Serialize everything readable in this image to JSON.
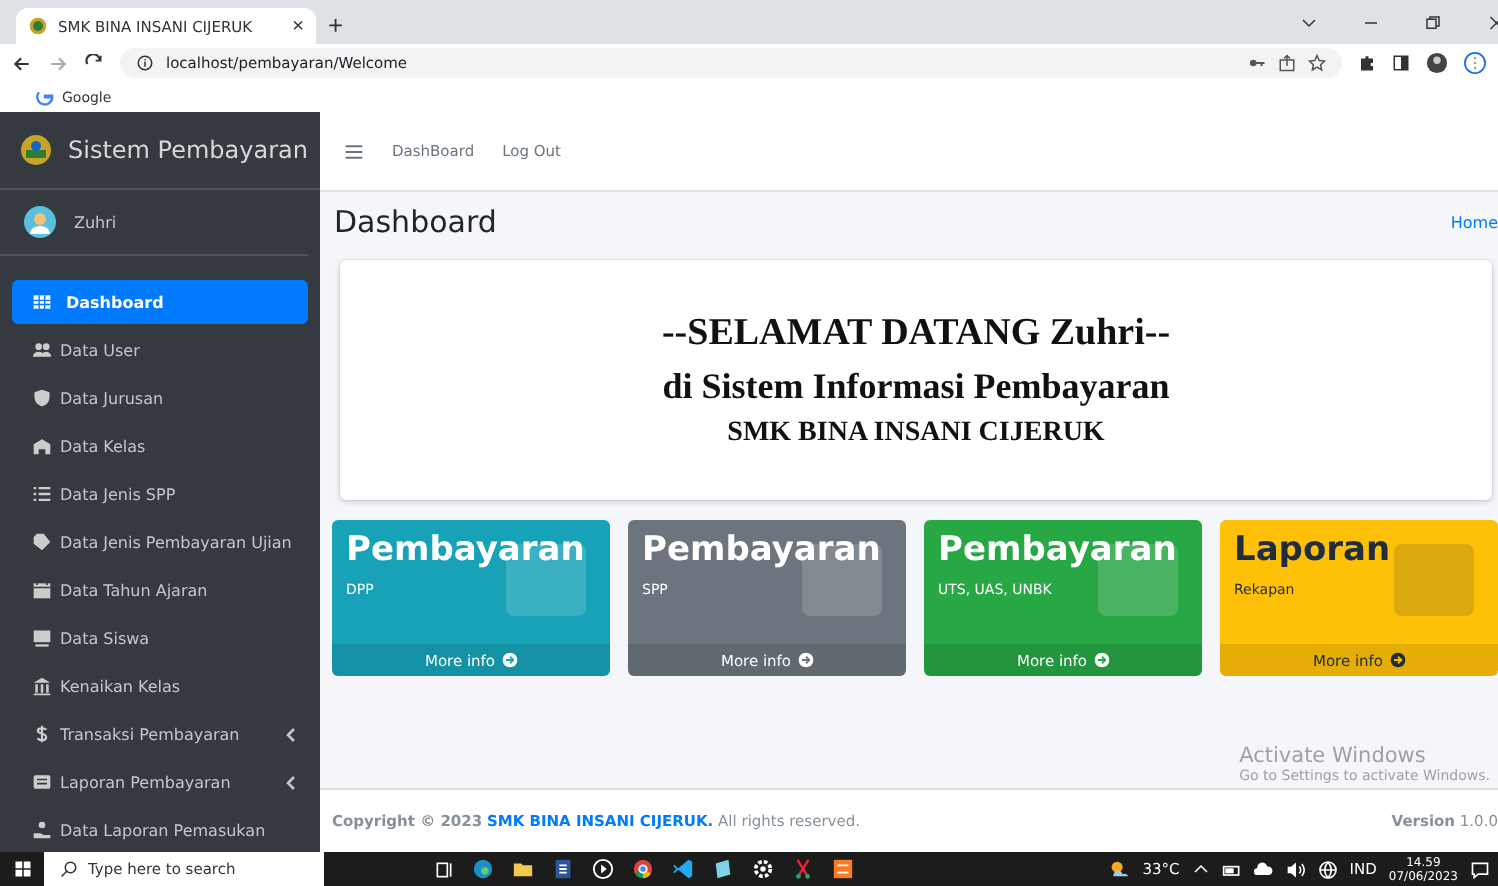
{
  "browser": {
    "tab_title": "SMK BINA INSANI CIJERUK",
    "new_tab": "+",
    "close_tab": "×",
    "url": "localhost/pembayaran/Welcome",
    "bookmark": "Google"
  },
  "sidebar": {
    "brand": "Sistem Pembayaran",
    "user": "Zuhri",
    "items": [
      {
        "label": "Dashboard",
        "selected": true,
        "has_submenu": false
      },
      {
        "label": "Data User",
        "selected": false,
        "has_submenu": false
      },
      {
        "label": "Data Jurusan",
        "selected": false,
        "has_submenu": false
      },
      {
        "label": "Data Kelas",
        "selected": false,
        "has_submenu": false
      },
      {
        "label": "Data Jenis SPP",
        "selected": false,
        "has_submenu": false
      },
      {
        "label": "Data Jenis Pembayaran Ujian",
        "selected": false,
        "has_submenu": false
      },
      {
        "label": "Data Tahun Ajaran",
        "selected": false,
        "has_submenu": false
      },
      {
        "label": "Data Siswa",
        "selected": false,
        "has_submenu": false
      },
      {
        "label": "Kenaikan Kelas",
        "selected": false,
        "has_submenu": false
      },
      {
        "label": "Transaksi Pembayaran",
        "selected": false,
        "has_submenu": true
      },
      {
        "label": "Laporan Pembayaran",
        "selected": false,
        "has_submenu": true
      },
      {
        "label": "Data Laporan Pemasukan",
        "selected": false,
        "has_submenu": false
      }
    ]
  },
  "navbar": {
    "links": [
      "DashBoard",
      "Log Out"
    ]
  },
  "page": {
    "title": "Dashboard",
    "breadcrumb": "Home"
  },
  "welcome": {
    "line1": "--SELAMAT DATANG Zuhri--",
    "line2": "di Sistem Informasi Pembayaran",
    "line3": "SMK BINA INSANI CIJERUK"
  },
  "boxes": [
    {
      "title": "Pembayaran",
      "subtitle": "DPP",
      "link": "More info",
      "color": "#17a2b8"
    },
    {
      "title": "Pembayaran",
      "subtitle": "SPP",
      "link": "More info",
      "color": "#6c757d"
    },
    {
      "title": "Pembayaran",
      "subtitle": "UTS, UAS, UNBK",
      "link": "More info",
      "color": "#28a745"
    },
    {
      "title": "Laporan",
      "subtitle": "Rekapan",
      "link": "More info",
      "color": "#ffc107"
    }
  ],
  "footer": {
    "copyright": "Copyright © 2023",
    "school": "SMK BINA INSANI CIJERUK.",
    "rights": "All rights reserved.",
    "version_label": "Version",
    "version": "1.0.0"
  },
  "watermark": {
    "title": "Activate Windows",
    "hint": "Go to Settings to activate Windows."
  },
  "taskbar": {
    "search_placeholder": "Type here to search",
    "temperature": "33°C",
    "language": "IND",
    "time": "14.59",
    "date": "07/06/2023"
  }
}
